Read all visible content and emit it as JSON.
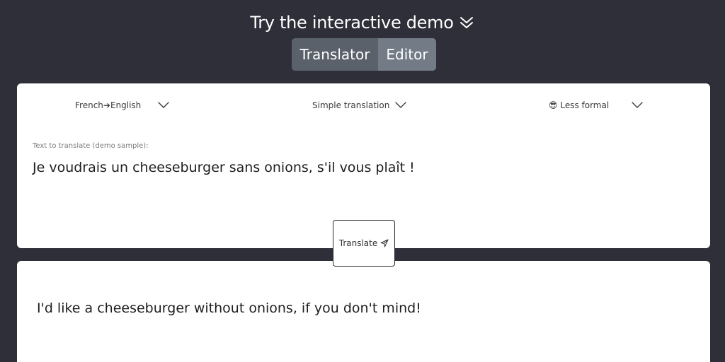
{
  "header": {
    "title": "Try the interactive demo",
    "chevron_icon": "double-chevron-down-icon"
  },
  "mode_toggle": {
    "translator_label": "Translator",
    "editor_label": "Editor"
  },
  "options": {
    "language_pair": "French➔English",
    "translation_mode": "Simple translation",
    "tone_emoji": "😎",
    "tone": "Less formal"
  },
  "input": {
    "label": "Text to translate (demo sample):",
    "text": "Je voudrais un cheeseburger sans onions, s'il vous plaît !"
  },
  "translate_button": {
    "label": "Translate",
    "icon": "send-icon"
  },
  "output": {
    "text": "I'd like a cheeseburger without onions, if you don't mind!"
  }
}
